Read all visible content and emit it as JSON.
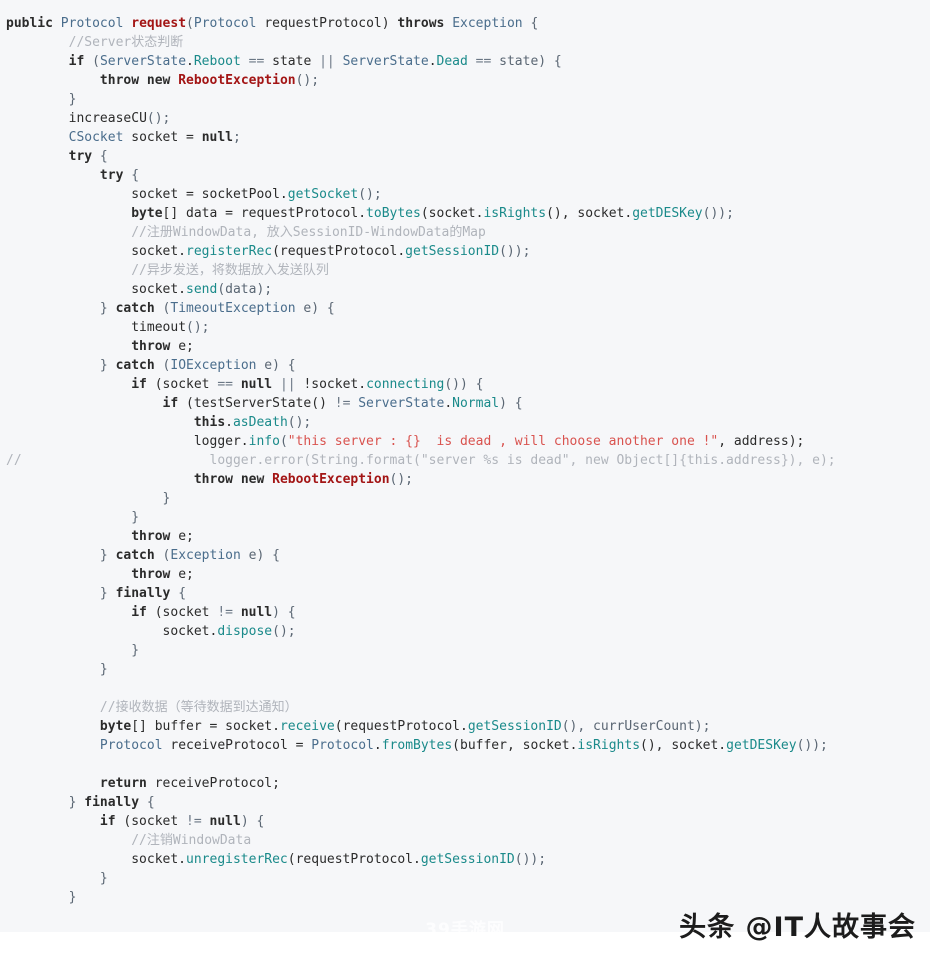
{
  "background_color": "#f6f7f9",
  "language": "java",
  "theme": {
    "keyword": "#2b2b2b",
    "type": "#4a6d8c",
    "method": "#1a8a8a",
    "string": "#d9534f",
    "comment": "#b0b4bb",
    "exception": "#a31515",
    "operator": "#6b7785",
    "plain": "#2b2b2b"
  },
  "watermarks": {
    "main": "头条 @IT人故事会",
    "faint": "39手游网"
  },
  "code": {
    "lines": [
      [
        [
          "public ",
          "kw"
        ],
        [
          "Protocol",
          "type"
        ],
        [
          " ",
          "plain"
        ],
        [
          "request",
          "fnname"
        ],
        [
          "(",
          "punc"
        ],
        [
          "Protocol",
          "type"
        ],
        [
          " requestProtocol) ",
          "plain"
        ],
        [
          "throws",
          "kw"
        ],
        [
          " ",
          "plain"
        ],
        [
          "Exception",
          "type"
        ],
        [
          " {",
          "punc"
        ]
      ],
      [
        [
          "        ",
          "plain"
        ],
        [
          "//Server状态判断",
          "comment"
        ]
      ],
      [
        [
          "        ",
          "plain"
        ],
        [
          "if",
          "kw"
        ],
        [
          " (",
          "punc"
        ],
        [
          "ServerState",
          "type"
        ],
        [
          ".",
          "plain"
        ],
        [
          "Reboot",
          "field"
        ],
        [
          " ",
          "plain"
        ],
        [
          "==",
          "op"
        ],
        [
          " state ",
          "plain"
        ],
        [
          "||",
          "op"
        ],
        [
          " ",
          "plain"
        ],
        [
          "ServerState",
          "type"
        ],
        [
          ".",
          "plain"
        ],
        [
          "Dead",
          "field"
        ],
        [
          " ",
          "plain"
        ],
        [
          "==",
          "op"
        ],
        [
          " state) {",
          "punc"
        ]
      ],
      [
        [
          "            ",
          "plain"
        ],
        [
          "throw",
          "kw"
        ],
        [
          " ",
          "plain"
        ],
        [
          "new",
          "kw"
        ],
        [
          " ",
          "plain"
        ],
        [
          "RebootException",
          "excls"
        ],
        [
          "();",
          "punc"
        ]
      ],
      [
        [
          "        ",
          "plain"
        ],
        [
          "}",
          "punc"
        ]
      ],
      [
        [
          "        ",
          "plain"
        ],
        [
          "increaseCU",
          "plain"
        ],
        [
          "();",
          "punc"
        ]
      ],
      [
        [
          "        ",
          "plain"
        ],
        [
          "CSocket",
          "type"
        ],
        [
          " socket = ",
          "plain"
        ],
        [
          "null",
          "kw"
        ],
        [
          ";",
          "punc"
        ]
      ],
      [
        [
          "        ",
          "plain"
        ],
        [
          "try",
          "kw"
        ],
        [
          " {",
          "punc"
        ]
      ],
      [
        [
          "            ",
          "plain"
        ],
        [
          "try",
          "kw"
        ],
        [
          " {",
          "punc"
        ]
      ],
      [
        [
          "                socket = socketPool.",
          "plain"
        ],
        [
          "getSocket",
          "method"
        ],
        [
          "();",
          "punc"
        ]
      ],
      [
        [
          "                ",
          "plain"
        ],
        [
          "byte",
          "kw"
        ],
        [
          "[] data = requestProtocol.",
          "plain"
        ],
        [
          "toBytes",
          "method"
        ],
        [
          "(socket.",
          "plain"
        ],
        [
          "isRights",
          "method"
        ],
        [
          "(), socket.",
          "plain"
        ],
        [
          "getDESKey",
          "method"
        ],
        [
          "());",
          "punc"
        ]
      ],
      [
        [
          "                ",
          "plain"
        ],
        [
          "//注册WindowData, 放入SessionID-WindowData的Map",
          "comment"
        ]
      ],
      [
        [
          "                socket.",
          "plain"
        ],
        [
          "registerRec",
          "method"
        ],
        [
          "(requestProtocol.",
          "plain"
        ],
        [
          "getSessionID",
          "method"
        ],
        [
          "());",
          "punc"
        ]
      ],
      [
        [
          "                ",
          "plain"
        ],
        [
          "//异步发送，将数据放入发送队列",
          "comment"
        ]
      ],
      [
        [
          "                socket.",
          "plain"
        ],
        [
          "send",
          "method"
        ],
        [
          "(data);",
          "punc"
        ]
      ],
      [
        [
          "            ",
          "plain"
        ],
        [
          "} ",
          "punc"
        ],
        [
          "catch",
          "kw"
        ],
        [
          " (",
          "punc"
        ],
        [
          "TimeoutException",
          "type"
        ],
        [
          " e) {",
          "punc"
        ]
      ],
      [
        [
          "                ",
          "plain"
        ],
        [
          "timeout",
          "plain"
        ],
        [
          "();",
          "punc"
        ]
      ],
      [
        [
          "                ",
          "plain"
        ],
        [
          "throw",
          "kw"
        ],
        [
          " e;",
          "plain"
        ]
      ],
      [
        [
          "            ",
          "plain"
        ],
        [
          "} ",
          "punc"
        ],
        [
          "catch",
          "kw"
        ],
        [
          " (",
          "punc"
        ],
        [
          "IOException",
          "type"
        ],
        [
          " e) {",
          "punc"
        ]
      ],
      [
        [
          "                ",
          "plain"
        ],
        [
          "if",
          "kw"
        ],
        [
          " (socket ",
          "plain"
        ],
        [
          "==",
          "op"
        ],
        [
          " ",
          "plain"
        ],
        [
          "null",
          "kw"
        ],
        [
          " ",
          "plain"
        ],
        [
          "||",
          "op"
        ],
        [
          " !socket.",
          "plain"
        ],
        [
          "connecting",
          "method"
        ],
        [
          "()) {",
          "punc"
        ]
      ],
      [
        [
          "                    ",
          "plain"
        ],
        [
          "if",
          "kw"
        ],
        [
          " (testServerState() ",
          "plain"
        ],
        [
          "!=",
          "op"
        ],
        [
          " ",
          "plain"
        ],
        [
          "ServerState",
          "type"
        ],
        [
          ".",
          "plain"
        ],
        [
          "Normal",
          "field"
        ],
        [
          ") {",
          "punc"
        ]
      ],
      [
        [
          "                        ",
          "plain"
        ],
        [
          "this",
          "kw"
        ],
        [
          ".",
          "plain"
        ],
        [
          "asDeath",
          "method"
        ],
        [
          "();",
          "punc"
        ]
      ],
      [
        [
          "                        logger.",
          "plain"
        ],
        [
          "info",
          "method"
        ],
        [
          "(",
          "punc"
        ],
        [
          "\"this server : {}  is dead , will choose another one !\"",
          "str"
        ],
        [
          ", address);",
          "plain"
        ]
      ],
      [
        [
          "//",
          "comment"
        ],
        [
          "                        logger.error(String.format(\"server %s is dead\", new Object[]{this.address}), e);",
          "comment"
        ]
      ],
      [
        [
          "                        ",
          "plain"
        ],
        [
          "throw",
          "kw"
        ],
        [
          " ",
          "plain"
        ],
        [
          "new",
          "kw"
        ],
        [
          " ",
          "plain"
        ],
        [
          "RebootException",
          "excls"
        ],
        [
          "();",
          "punc"
        ]
      ],
      [
        [
          "                    ",
          "plain"
        ],
        [
          "}",
          "punc"
        ]
      ],
      [
        [
          "                ",
          "plain"
        ],
        [
          "}",
          "punc"
        ]
      ],
      [
        [
          "                ",
          "plain"
        ],
        [
          "throw",
          "kw"
        ],
        [
          " e;",
          "plain"
        ]
      ],
      [
        [
          "            ",
          "plain"
        ],
        [
          "} ",
          "punc"
        ],
        [
          "catch",
          "kw"
        ],
        [
          " (",
          "punc"
        ],
        [
          "Exception",
          "type"
        ],
        [
          " e) {",
          "punc"
        ]
      ],
      [
        [
          "                ",
          "plain"
        ],
        [
          "throw",
          "kw"
        ],
        [
          " e;",
          "plain"
        ]
      ],
      [
        [
          "            ",
          "plain"
        ],
        [
          "} ",
          "punc"
        ],
        [
          "finally",
          "kw"
        ],
        [
          " {",
          "punc"
        ]
      ],
      [
        [
          "                ",
          "plain"
        ],
        [
          "if",
          "kw"
        ],
        [
          " (socket ",
          "plain"
        ],
        [
          "!=",
          "op"
        ],
        [
          " ",
          "plain"
        ],
        [
          "null",
          "kw"
        ],
        [
          ") {",
          "punc"
        ]
      ],
      [
        [
          "                    socket.",
          "plain"
        ],
        [
          "dispose",
          "method"
        ],
        [
          "();",
          "punc"
        ]
      ],
      [
        [
          "                ",
          "plain"
        ],
        [
          "}",
          "punc"
        ]
      ],
      [
        [
          "            ",
          "plain"
        ],
        [
          "}",
          "punc"
        ]
      ],
      [
        [
          "",
          "plain"
        ]
      ],
      [
        [
          "            ",
          "plain"
        ],
        [
          "//接收数据（等待数据到达通知）",
          "comment"
        ]
      ],
      [
        [
          "            ",
          "plain"
        ],
        [
          "byte",
          "kw"
        ],
        [
          "[] buffer = socket.",
          "plain"
        ],
        [
          "receive",
          "method"
        ],
        [
          "(requestProtocol.",
          "plain"
        ],
        [
          "getSessionID",
          "method"
        ],
        [
          "(), currUserCount);",
          "punc"
        ]
      ],
      [
        [
          "            ",
          "plain"
        ],
        [
          "Protocol",
          "type"
        ],
        [
          " receiveProtocol = ",
          "plain"
        ],
        [
          "Protocol",
          "type"
        ],
        [
          ".",
          "plain"
        ],
        [
          "fromBytes",
          "method"
        ],
        [
          "(buffer, socket.",
          "plain"
        ],
        [
          "isRights",
          "method"
        ],
        [
          "(), socket.",
          "plain"
        ],
        [
          "getDESKey",
          "method"
        ],
        [
          "());",
          "punc"
        ]
      ],
      [
        [
          "",
          "plain"
        ]
      ],
      [
        [
          "            ",
          "plain"
        ],
        [
          "return",
          "kw"
        ],
        [
          " receiveProtocol;",
          "plain"
        ]
      ],
      [
        [
          "        ",
          "plain"
        ],
        [
          "} ",
          "punc"
        ],
        [
          "finally",
          "kw"
        ],
        [
          " {",
          "punc"
        ]
      ],
      [
        [
          "            ",
          "plain"
        ],
        [
          "if",
          "kw"
        ],
        [
          " (socket ",
          "plain"
        ],
        [
          "!=",
          "op"
        ],
        [
          " ",
          "plain"
        ],
        [
          "null",
          "kw"
        ],
        [
          ") {",
          "punc"
        ]
      ],
      [
        [
          "                ",
          "plain"
        ],
        [
          "//注销WindowData",
          "comment"
        ]
      ],
      [
        [
          "                socket.",
          "plain"
        ],
        [
          "unregisterRec",
          "method"
        ],
        [
          "(requestProtocol.",
          "plain"
        ],
        [
          "getSessionID",
          "method"
        ],
        [
          "());",
          "punc"
        ]
      ],
      [
        [
          "            ",
          "plain"
        ],
        [
          "}",
          "punc"
        ]
      ],
      [
        [
          "        ",
          "plain"
        ],
        [
          "}",
          "punc"
        ]
      ]
    ]
  }
}
